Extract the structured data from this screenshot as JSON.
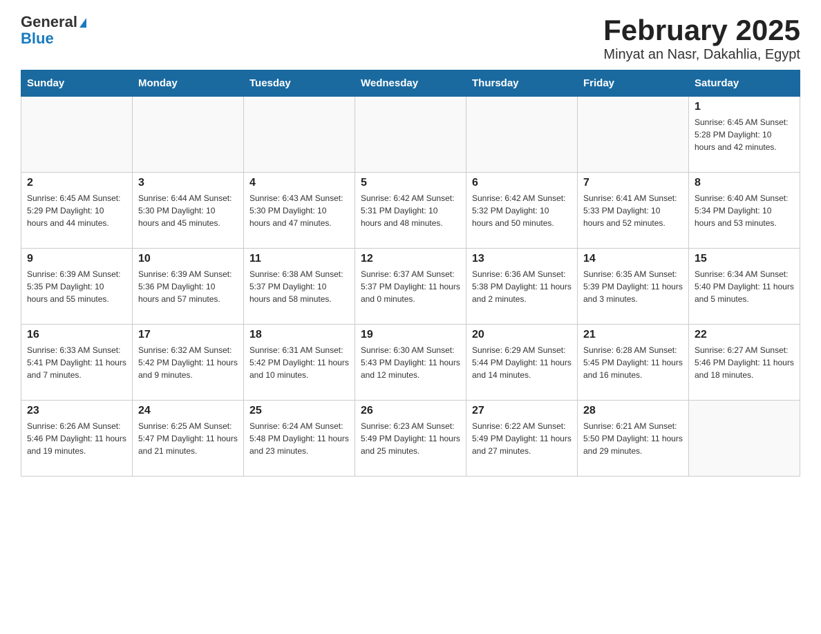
{
  "header": {
    "logo_general": "General",
    "logo_blue": "Blue",
    "title": "February 2025",
    "subtitle": "Minyat an Nasr, Dakahlia, Egypt"
  },
  "days_of_week": [
    "Sunday",
    "Monday",
    "Tuesday",
    "Wednesday",
    "Thursday",
    "Friday",
    "Saturday"
  ],
  "weeks": [
    [
      {
        "day": "",
        "info": ""
      },
      {
        "day": "",
        "info": ""
      },
      {
        "day": "",
        "info": ""
      },
      {
        "day": "",
        "info": ""
      },
      {
        "day": "",
        "info": ""
      },
      {
        "day": "",
        "info": ""
      },
      {
        "day": "1",
        "info": "Sunrise: 6:45 AM\nSunset: 5:28 PM\nDaylight: 10 hours and 42 minutes."
      }
    ],
    [
      {
        "day": "2",
        "info": "Sunrise: 6:45 AM\nSunset: 5:29 PM\nDaylight: 10 hours and 44 minutes."
      },
      {
        "day": "3",
        "info": "Sunrise: 6:44 AM\nSunset: 5:30 PM\nDaylight: 10 hours and 45 minutes."
      },
      {
        "day": "4",
        "info": "Sunrise: 6:43 AM\nSunset: 5:30 PM\nDaylight: 10 hours and 47 minutes."
      },
      {
        "day": "5",
        "info": "Sunrise: 6:42 AM\nSunset: 5:31 PM\nDaylight: 10 hours and 48 minutes."
      },
      {
        "day": "6",
        "info": "Sunrise: 6:42 AM\nSunset: 5:32 PM\nDaylight: 10 hours and 50 minutes."
      },
      {
        "day": "7",
        "info": "Sunrise: 6:41 AM\nSunset: 5:33 PM\nDaylight: 10 hours and 52 minutes."
      },
      {
        "day": "8",
        "info": "Sunrise: 6:40 AM\nSunset: 5:34 PM\nDaylight: 10 hours and 53 minutes."
      }
    ],
    [
      {
        "day": "9",
        "info": "Sunrise: 6:39 AM\nSunset: 5:35 PM\nDaylight: 10 hours and 55 minutes."
      },
      {
        "day": "10",
        "info": "Sunrise: 6:39 AM\nSunset: 5:36 PM\nDaylight: 10 hours and 57 minutes."
      },
      {
        "day": "11",
        "info": "Sunrise: 6:38 AM\nSunset: 5:37 PM\nDaylight: 10 hours and 58 minutes."
      },
      {
        "day": "12",
        "info": "Sunrise: 6:37 AM\nSunset: 5:37 PM\nDaylight: 11 hours and 0 minutes."
      },
      {
        "day": "13",
        "info": "Sunrise: 6:36 AM\nSunset: 5:38 PM\nDaylight: 11 hours and 2 minutes."
      },
      {
        "day": "14",
        "info": "Sunrise: 6:35 AM\nSunset: 5:39 PM\nDaylight: 11 hours and 3 minutes."
      },
      {
        "day": "15",
        "info": "Sunrise: 6:34 AM\nSunset: 5:40 PM\nDaylight: 11 hours and 5 minutes."
      }
    ],
    [
      {
        "day": "16",
        "info": "Sunrise: 6:33 AM\nSunset: 5:41 PM\nDaylight: 11 hours and 7 minutes."
      },
      {
        "day": "17",
        "info": "Sunrise: 6:32 AM\nSunset: 5:42 PM\nDaylight: 11 hours and 9 minutes."
      },
      {
        "day": "18",
        "info": "Sunrise: 6:31 AM\nSunset: 5:42 PM\nDaylight: 11 hours and 10 minutes."
      },
      {
        "day": "19",
        "info": "Sunrise: 6:30 AM\nSunset: 5:43 PM\nDaylight: 11 hours and 12 minutes."
      },
      {
        "day": "20",
        "info": "Sunrise: 6:29 AM\nSunset: 5:44 PM\nDaylight: 11 hours and 14 minutes."
      },
      {
        "day": "21",
        "info": "Sunrise: 6:28 AM\nSunset: 5:45 PM\nDaylight: 11 hours and 16 minutes."
      },
      {
        "day": "22",
        "info": "Sunrise: 6:27 AM\nSunset: 5:46 PM\nDaylight: 11 hours and 18 minutes."
      }
    ],
    [
      {
        "day": "23",
        "info": "Sunrise: 6:26 AM\nSunset: 5:46 PM\nDaylight: 11 hours and 19 minutes."
      },
      {
        "day": "24",
        "info": "Sunrise: 6:25 AM\nSunset: 5:47 PM\nDaylight: 11 hours and 21 minutes."
      },
      {
        "day": "25",
        "info": "Sunrise: 6:24 AM\nSunset: 5:48 PM\nDaylight: 11 hours and 23 minutes."
      },
      {
        "day": "26",
        "info": "Sunrise: 6:23 AM\nSunset: 5:49 PM\nDaylight: 11 hours and 25 minutes."
      },
      {
        "day": "27",
        "info": "Sunrise: 6:22 AM\nSunset: 5:49 PM\nDaylight: 11 hours and 27 minutes."
      },
      {
        "day": "28",
        "info": "Sunrise: 6:21 AM\nSunset: 5:50 PM\nDaylight: 11 hours and 29 minutes."
      },
      {
        "day": "",
        "info": ""
      }
    ]
  ]
}
